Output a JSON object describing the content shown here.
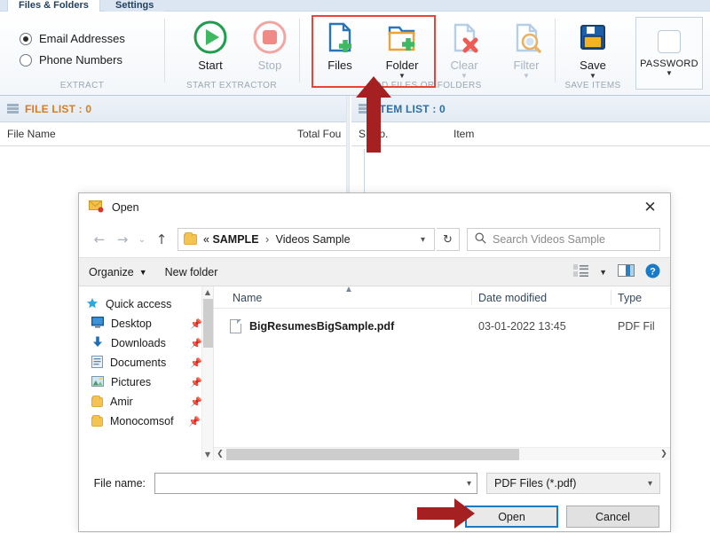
{
  "app": {
    "tabs": [
      {
        "label": "Files & Folders",
        "active": true
      },
      {
        "label": "Settings",
        "active": false
      }
    ],
    "ribbon": {
      "groups": [
        {
          "label": "EXTRACT"
        },
        {
          "label": "START EXTRACTOR"
        },
        {
          "label": "ADD FILES OR FOLDERS"
        },
        {
          "label": "SAVE ITEMS"
        }
      ],
      "extract_options": [
        {
          "label": "Email Addresses",
          "selected": true
        },
        {
          "label": "Phone Numbers",
          "selected": false
        }
      ],
      "buttons": [
        {
          "label": "Start",
          "icon": "play-icon",
          "enabled": true
        },
        {
          "label": "Stop",
          "icon": "stop-icon",
          "enabled": false
        },
        {
          "label": "Files",
          "icon": "add-file-icon",
          "enabled": true
        },
        {
          "label": "Folder",
          "icon": "add-folder-icon",
          "enabled": true
        },
        {
          "label": "Clear",
          "icon": "clear-file-icon",
          "enabled": false
        },
        {
          "label": "Filter",
          "icon": "filter-search-icon",
          "enabled": false
        },
        {
          "label": "Save",
          "icon": "save-floppy-icon",
          "enabled": true
        }
      ],
      "password_label": "PASSWORD"
    },
    "file_list": {
      "header": "FILE LIST : 0",
      "header_color": "#e07a18",
      "columns": [
        "File Name",
        "Total Fou"
      ]
    },
    "item_list": {
      "header": "ITEM LIST : 0",
      "header_color": "#2d6fa8",
      "columns": [
        "S. No.",
        "Item"
      ]
    }
  },
  "dialog": {
    "title": "Open",
    "title_icon": "mail-open-icon",
    "close_label": "✕",
    "nav": {
      "back": "←",
      "forward": "→",
      "recent": "⌄",
      "up": "↑",
      "refresh": "↻"
    },
    "breadcrumb": {
      "prefix": "«",
      "parts": [
        "SAMPLE",
        "Videos Sample"
      ],
      "separator": "›"
    },
    "search": {
      "placeholder": "Search Videos Sample",
      "icon": "search-icon"
    },
    "toolbar": {
      "organize": "Organize",
      "new_folder": "New folder",
      "view_icon": "view-layout-icon",
      "preview_icon": "preview-pane-icon",
      "help_icon": "help-icon",
      "help_glyph": "?"
    },
    "nav_pane": [
      {
        "label": "Quick access",
        "icon": "star-icon",
        "pinned": false
      },
      {
        "label": "Desktop",
        "icon": "desktop-icon",
        "pinned": true
      },
      {
        "label": "Downloads",
        "icon": "download-icon",
        "pinned": true
      },
      {
        "label": "Documents",
        "icon": "documents-icon",
        "pinned": true
      },
      {
        "label": "Pictures",
        "icon": "pictures-icon",
        "pinned": true
      },
      {
        "label": "Amir",
        "icon": "folder-icon",
        "pinned": true
      },
      {
        "label": "Monocomsof",
        "icon": "folder-icon",
        "pinned": true
      }
    ],
    "file_columns": [
      "Name",
      "Date modified",
      "Type"
    ],
    "files": [
      {
        "name": "BigResumesBigSample.pdf",
        "date": "03-01-2022 13:45",
        "type": "PDF Fil",
        "icon": "document-icon"
      }
    ],
    "footer": {
      "file_name_label": "File name:",
      "file_name_value": "",
      "file_type": "PDF Files (*.pdf)",
      "open_button": "Open",
      "cancel_button": "Cancel"
    }
  },
  "annotations": {
    "highlight_color": "#e8443a",
    "arrow_color": "#a52020"
  }
}
